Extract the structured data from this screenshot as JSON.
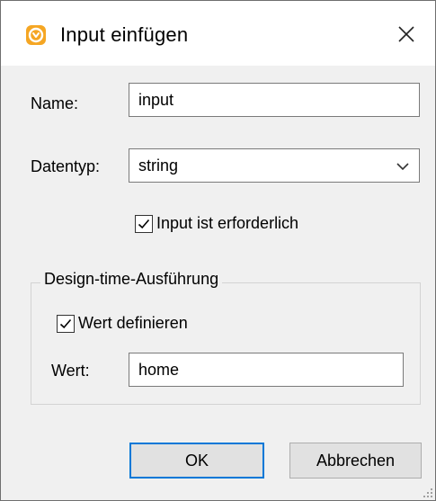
{
  "window": {
    "title": "Input einfügen",
    "app_icon": "altova-mapforce-icon",
    "close_icon": "close-icon",
    "close_glyph": "✕"
  },
  "form": {
    "name_label": "Name:",
    "name_value": "input",
    "datatype_label": "Datentyp:",
    "datatype_value": "string",
    "datatype_dropdown_icon": "chevron-down-icon",
    "required_checkbox": {
      "label": "Input ist erforderlich",
      "checked": true
    }
  },
  "design_time": {
    "group_title": "Design-time-Ausführung",
    "define_value_checkbox": {
      "label": "Wert definieren",
      "checked": true
    },
    "value_label": "Wert:",
    "value": "home"
  },
  "buttons": {
    "ok_label": "OK",
    "cancel_label": "Abbrechen"
  },
  "colors": {
    "dialog_background": "#f0f0f0",
    "titlebar_background": "#ffffff",
    "accent_focus": "#0078d7",
    "app_icon_orange": "#f5a623"
  }
}
